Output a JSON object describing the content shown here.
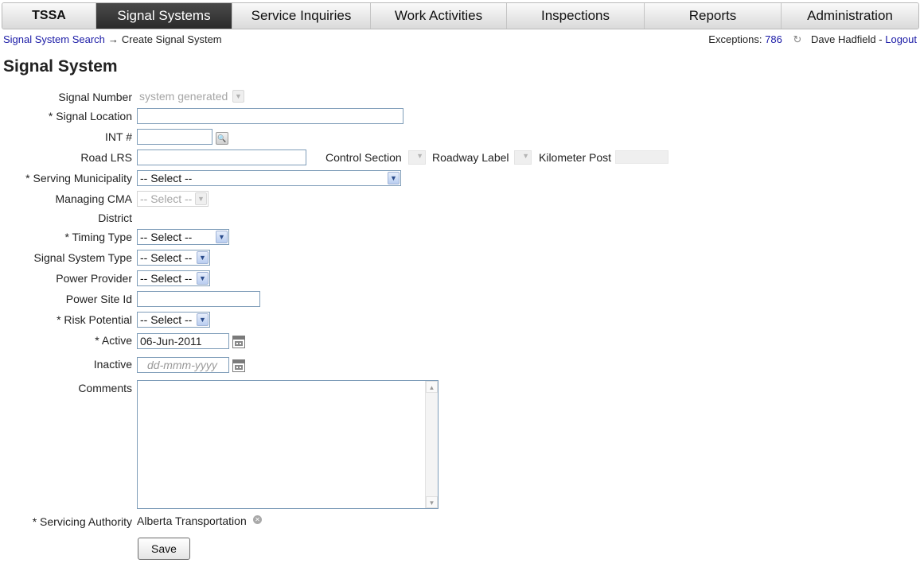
{
  "nav": {
    "items": [
      {
        "label": "TSSA"
      },
      {
        "label": "Signal Systems"
      },
      {
        "label": "Service Inquiries"
      },
      {
        "label": "Work Activities"
      },
      {
        "label": "Inspections"
      },
      {
        "label": "Reports"
      },
      {
        "label": "Administration"
      }
    ],
    "active_index": 1
  },
  "breadcrumb": {
    "link": "Signal System Search",
    "separator": "→",
    "current": "Create Signal System"
  },
  "userbar": {
    "exceptions_label": "Exceptions:",
    "exceptions_count": "786",
    "user_name": "Dave Hadfield",
    "dash": "-",
    "logout": "Logout"
  },
  "page": {
    "title": "Signal System"
  },
  "form": {
    "signal_number": {
      "label": "Signal Number",
      "value": "system generated"
    },
    "signal_location": {
      "label": "* Signal Location",
      "value": ""
    },
    "int": {
      "label": "INT #",
      "value": ""
    },
    "road_lrs": {
      "label": "Road LRS",
      "value": ""
    },
    "control_section": {
      "label": "Control Section"
    },
    "roadway_label": {
      "label": "Roadway Label"
    },
    "kilometer_post": {
      "label": "Kilometer Post"
    },
    "serving_municipality": {
      "label": "* Serving Municipality",
      "value": "-- Select --"
    },
    "managing_cma": {
      "label": "Managing CMA",
      "value": "-- Select --"
    },
    "district": {
      "label": "District"
    },
    "timing_type": {
      "label": "* Timing Type",
      "value": "-- Select --"
    },
    "signal_system_type": {
      "label": "Signal System Type",
      "value": "-- Select --"
    },
    "power_provider": {
      "label": "Power Provider",
      "value": "-- Select --"
    },
    "power_site_id": {
      "label": "Power Site Id",
      "value": ""
    },
    "risk_potential": {
      "label": "* Risk Potential",
      "value": "-- Select --"
    },
    "active": {
      "label": "* Active",
      "value": "06-Jun-2011"
    },
    "inactive": {
      "label": "Inactive",
      "value": "",
      "placeholder": "dd-mmm-yyyy"
    },
    "comments": {
      "label": "Comments",
      "value": ""
    },
    "servicing_authority": {
      "label": "* Servicing Authority",
      "value": "Alberta Transportation"
    },
    "save": "Save"
  },
  "icons": {
    "search": "magnifier-icon",
    "calendar": "calendar-icon",
    "clear": "clear-icon",
    "refresh": "refresh-icon",
    "dropdown": "chevron-down-icon"
  },
  "colors": {
    "active_tab": "#333333",
    "link": "#1a1aa6",
    "field_border": "#7f9db9"
  }
}
